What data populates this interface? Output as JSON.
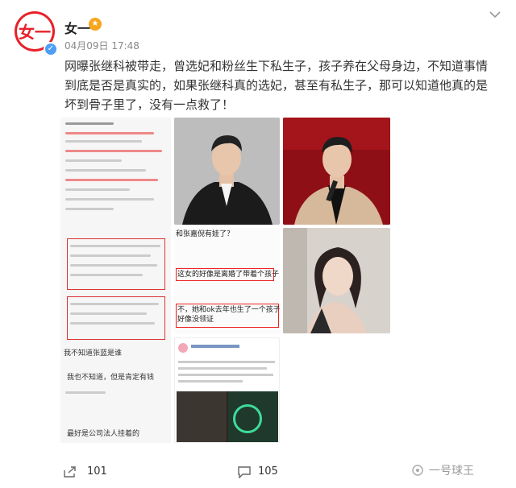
{
  "header": {
    "username": "女一",
    "avatar_text": "女一",
    "timestamp": "04月09日 17:48",
    "badge_icon": "crown-badge-icon",
    "verified_icon": "verified-v-icon",
    "more_icon": "chevron-down-icon"
  },
  "post": {
    "text": "网曝张继科被带走，曾选妃和粉丝生下私生子，孩子养在父母身边，不知道事情到底是否是真实的，如果张继科真的选妃，甚至有私生子，那可以知道他真的是坏到骨子里了，没有一点救了！"
  },
  "images": {
    "mid_lines": [
      "和张嘉倪有娃了？",
      "这女的好像是离婚了带着个孩子",
      "不，她和ok去年也生了一个孩子的，",
      "好像没领证"
    ],
    "left_lines": [
      "我不知道张蓝是谁",
      "我也不知道，但是肯定有钱",
      "最好是公司法人挂着的"
    ]
  },
  "footer": {
    "share_count": "101",
    "comment_count": "105",
    "share_icon": "share-icon",
    "comment_icon": "comment-icon"
  },
  "watermark": {
    "text": "一号球王"
  }
}
